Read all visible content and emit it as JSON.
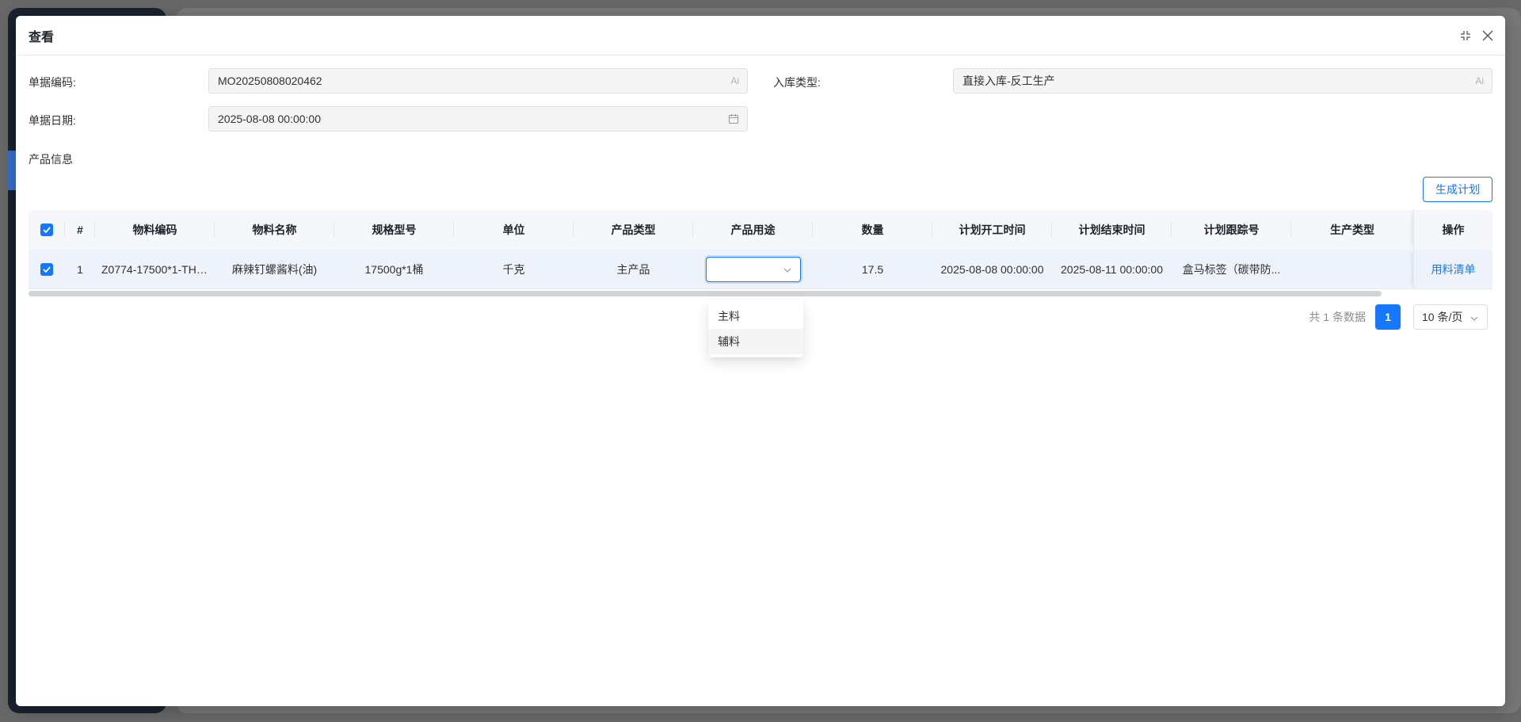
{
  "dialog": {
    "title": "查看"
  },
  "form": {
    "doc_code_label": "单据编码:",
    "doc_code_value": "MO20250808020462",
    "doc_code_suffix": "Ai",
    "type_label": "入库类型:",
    "type_value": "直接入库-反工生产",
    "type_suffix": "Ai",
    "date_label": "单据日期:",
    "date_value": "2025-08-08 00:00:00"
  },
  "section_title": "产品信息",
  "generate_button": "生成计划",
  "table": {
    "headers": [
      "#",
      "物料编码",
      "物料名称",
      "规格型号",
      "单位",
      "产品类型",
      "产品用途",
      "数量",
      "计划开工时间",
      "计划结束时间",
      "计划跟踪号",
      "生产类型",
      "操作"
    ],
    "rows": [
      {
        "index": "1",
        "material_code": "Z0774-17500*1-TH-...",
        "material_name": "麻辣钉螺酱料(油)",
        "spec": "17500g*1桶",
        "unit": "千克",
        "product_type": "主产品",
        "usage": "",
        "quantity": "17.5",
        "plan_start": "2025-08-08 00:00:00",
        "plan_end": "2025-08-11 00:00:00",
        "tracking_no": "盒马标签（碳带防...",
        "production_type": "",
        "action": "用料清单"
      }
    ]
  },
  "dropdown": {
    "options": [
      "主料",
      "辅料"
    ],
    "highlighted": "辅料"
  },
  "pagination": {
    "total": "共 1 条数据",
    "current_page": "1",
    "page_size": "10 条/页"
  },
  "colors": {
    "primary": "#1677ff",
    "header_bg": "#f5f7fa",
    "row_bg": "#eef3fb"
  }
}
